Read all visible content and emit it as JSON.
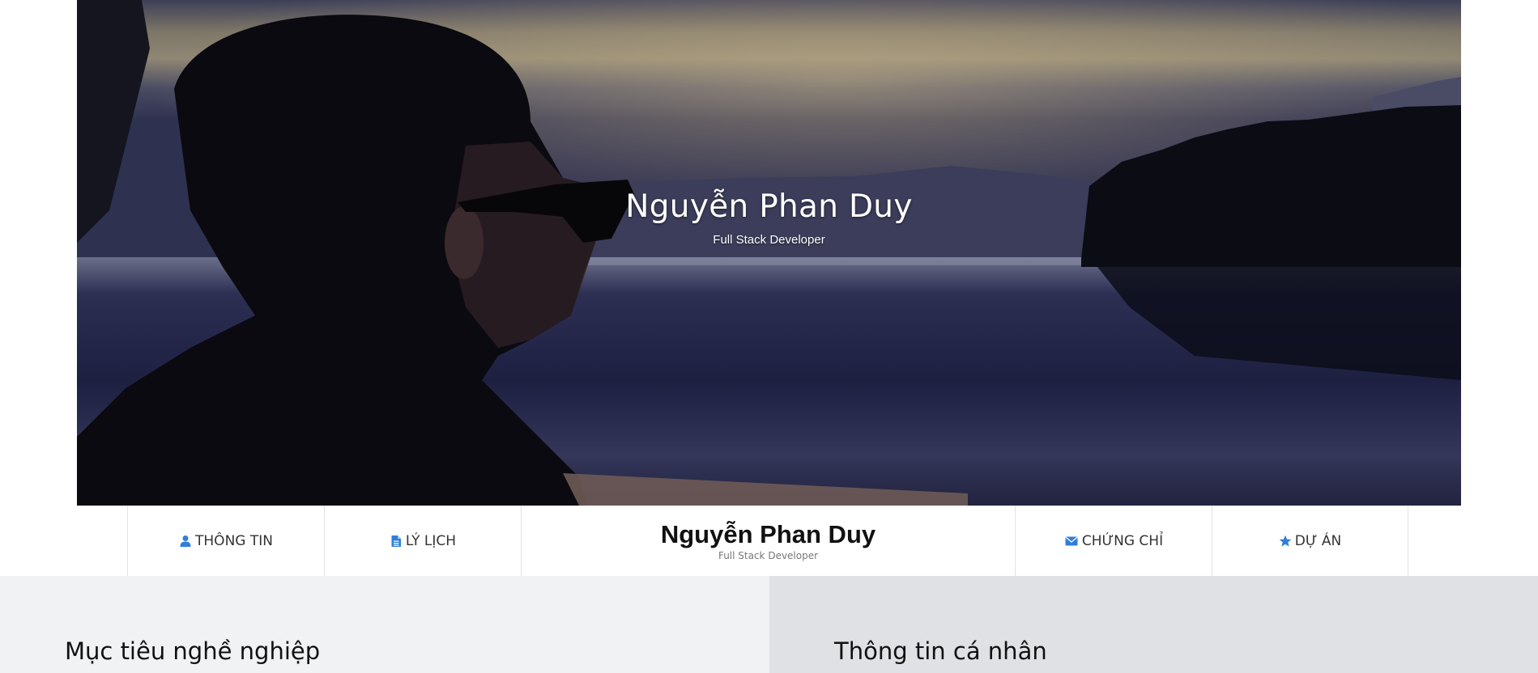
{
  "hero": {
    "name": "Nguyễn Phan Duy",
    "tagline": "Full Stack Developer"
  },
  "nav": {
    "items_left": [
      {
        "label": "THÔNG TIN",
        "icon": "user-icon"
      },
      {
        "label": "LÝ LỊCH",
        "icon": "document-icon"
      }
    ],
    "brand": {
      "name": "Nguyễn Phan Duy",
      "tagline": "Full Stack Developer"
    },
    "items_right": [
      {
        "label": "CHỨNG CHỈ",
        "icon": "envelope-icon"
      },
      {
        "label": "DỰ ÁN",
        "icon": "star-icon"
      }
    ]
  },
  "sections": {
    "left_heading": "Mục tiêu nghề nghiệp",
    "right_heading": "Thông tin cá nhân"
  },
  "colors": {
    "accent_icon": "#2f7fd8",
    "left_bg": "#f1f2f4",
    "right_bg": "#dfe1e5"
  }
}
